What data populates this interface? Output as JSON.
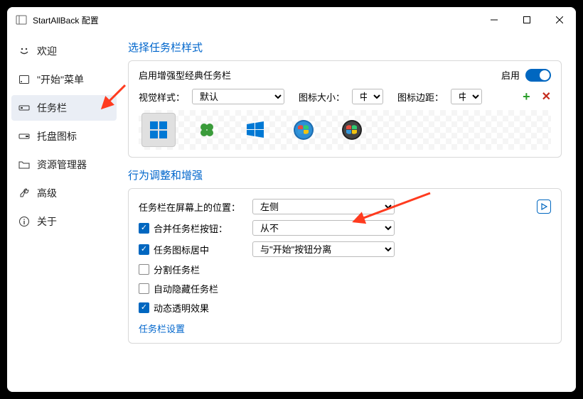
{
  "titlebar": {
    "title": "StartAllBack 配置"
  },
  "sidebar": {
    "items": [
      {
        "label": "欢迎"
      },
      {
        "label": "\"开始\"菜单"
      },
      {
        "label": "任务栏"
      },
      {
        "label": "托盘图标"
      },
      {
        "label": "资源管理器"
      },
      {
        "label": "高级"
      },
      {
        "label": "关于"
      }
    ]
  },
  "sections": {
    "style_title": "选择任务栏样式",
    "behavior_title": "行为调整和增强"
  },
  "style_panel": {
    "enable_label": "启用增强型经典任务栏",
    "toggle_label": "启用",
    "visual_style_label": "视觉样式：",
    "visual_style_value": "默认",
    "icon_size_label": "图标大小：",
    "icon_size_value": "中",
    "icon_margin_label": "图标边距：",
    "icon_margin_value": "中"
  },
  "behavior": {
    "position_label": "任务栏在屏幕上的位置：",
    "position_value": "左侧",
    "combine_label": "合并任务栏按钮：",
    "combine_value": "从不",
    "center_label": "任务图标居中",
    "center_value": "与\"开始\"按钮分离",
    "split_label": "分割任务栏",
    "autohide_label": "自动隐藏任务栏",
    "transparency_label": "动态透明效果",
    "settings_link": "任务栏设置"
  }
}
